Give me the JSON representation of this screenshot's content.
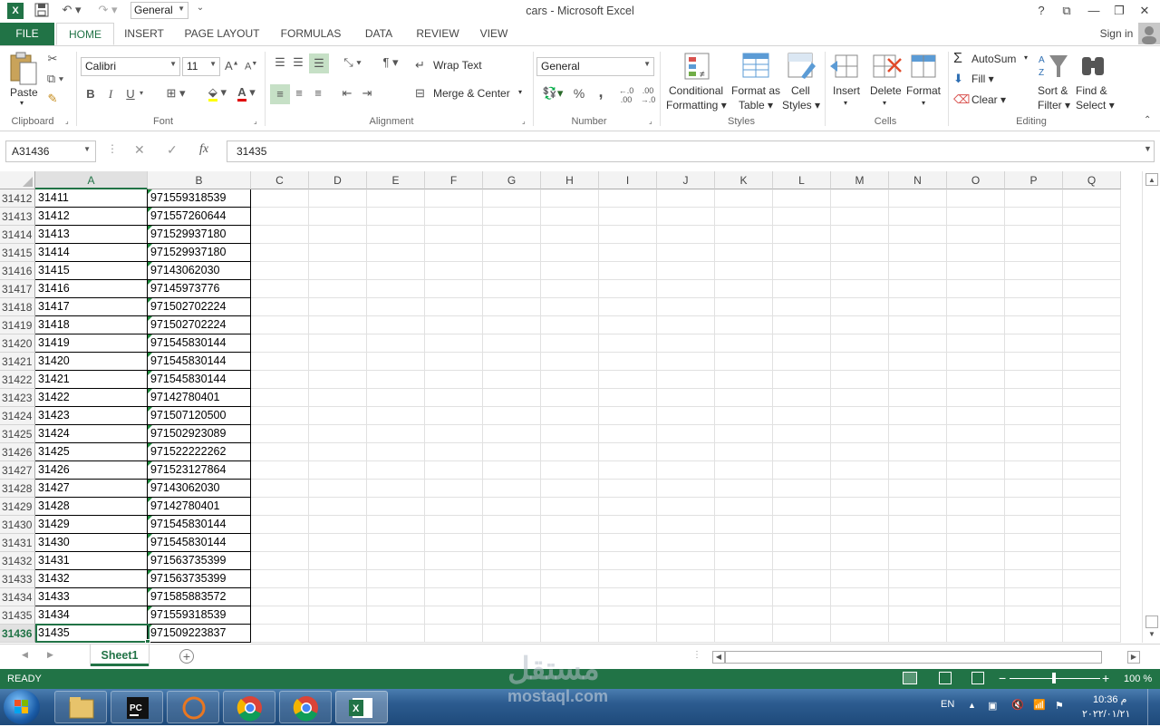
{
  "window": {
    "title": "cars - Microsoft Excel",
    "qat_format": "General",
    "help": "?",
    "signin": "Sign in"
  },
  "tabs": [
    "FILE",
    "HOME",
    "INSERT",
    "PAGE LAYOUT",
    "FORMULAS",
    "DATA",
    "REVIEW",
    "VIEW"
  ],
  "ribbon": {
    "clipboard": {
      "paste": "Paste",
      "label": "Clipboard"
    },
    "font": {
      "name": "Calibri",
      "size": "11",
      "label": "Font",
      "bold": "B",
      "italic": "I",
      "underline": "U"
    },
    "alignment": {
      "wrap": "Wrap Text",
      "merge": "Merge & Center",
      "label": "Alignment"
    },
    "number": {
      "format": "General",
      "percent": "%",
      "comma": ",",
      "label": "Number"
    },
    "styles": {
      "conditional1": "Conditional",
      "conditional2": "Formatting",
      "format_as1": "Format as",
      "format_as2": "Table",
      "cell_styles1": "Cell",
      "cell_styles2": "Styles",
      "label": "Styles"
    },
    "cells": {
      "insert": "Insert",
      "delete": "Delete",
      "format": "Format",
      "label": "Cells"
    },
    "editing": {
      "autosum": "AutoSum",
      "fill": "Fill",
      "clear": "Clear",
      "sort1": "Sort &",
      "sort2": "Filter",
      "find1": "Find &",
      "find2": "Select",
      "label": "Editing"
    }
  },
  "formula_bar": {
    "name_box": "A31436",
    "fx": "fx",
    "value": "31435"
  },
  "columns": [
    "A",
    "B",
    "C",
    "D",
    "E",
    "F",
    "G",
    "H",
    "I",
    "J",
    "K",
    "L",
    "M",
    "N",
    "O",
    "P",
    "Q"
  ],
  "rows": [
    {
      "num": "31412",
      "a": "31411",
      "b": "971559318539"
    },
    {
      "num": "31413",
      "a": "31412",
      "b": "971557260644"
    },
    {
      "num": "31414",
      "a": "31413",
      "b": "971529937180"
    },
    {
      "num": "31415",
      "a": "31414",
      "b": "971529937180"
    },
    {
      "num": "31416",
      "a": "31415",
      "b": "97143062030"
    },
    {
      "num": "31417",
      "a": "31416",
      "b": "97145973776"
    },
    {
      "num": "31418",
      "a": "31417",
      "b": "971502702224"
    },
    {
      "num": "31419",
      "a": "31418",
      "b": "971502702224"
    },
    {
      "num": "31420",
      "a": "31419",
      "b": "971545830144"
    },
    {
      "num": "31421",
      "a": "31420",
      "b": "971545830144"
    },
    {
      "num": "31422",
      "a": "31421",
      "b": "971545830144"
    },
    {
      "num": "31423",
      "a": "31422",
      "b": "97142780401"
    },
    {
      "num": "31424",
      "a": "31423",
      "b": "971507120500"
    },
    {
      "num": "31425",
      "a": "31424",
      "b": "971502923089"
    },
    {
      "num": "31426",
      "a": "31425",
      "b": "971522222262"
    },
    {
      "num": "31427",
      "a": "31426",
      "b": "971523127864"
    },
    {
      "num": "31428",
      "a": "31427",
      "b": "97143062030"
    },
    {
      "num": "31429",
      "a": "31428",
      "b": "97142780401"
    },
    {
      "num": "31430",
      "a": "31429",
      "b": "971545830144"
    },
    {
      "num": "31431",
      "a": "31430",
      "b": "971545830144"
    },
    {
      "num": "31432",
      "a": "31431",
      "b": "971563735399"
    },
    {
      "num": "31433",
      "a": "31432",
      "b": "971563735399"
    },
    {
      "num": "31434",
      "a": "31433",
      "b": "971585883572"
    },
    {
      "num": "31435",
      "a": "31434",
      "b": "971559318539"
    },
    {
      "num": "31436",
      "a": "31435",
      "b": "971509223837"
    }
  ],
  "sheet": {
    "tab": "Sheet1",
    "add": "+"
  },
  "status": {
    "ready": "READY",
    "zoom": "100 %"
  },
  "taskbar": {
    "lang": "EN",
    "time": "10:36 م",
    "date": "٢٠٢٢/٠١/٢١"
  },
  "watermark": {
    "arabic": "مستقل",
    "latin": "mostaql.com"
  },
  "colors": {
    "excel_green": "#217346",
    "taskbar": "#2c5b8f"
  }
}
